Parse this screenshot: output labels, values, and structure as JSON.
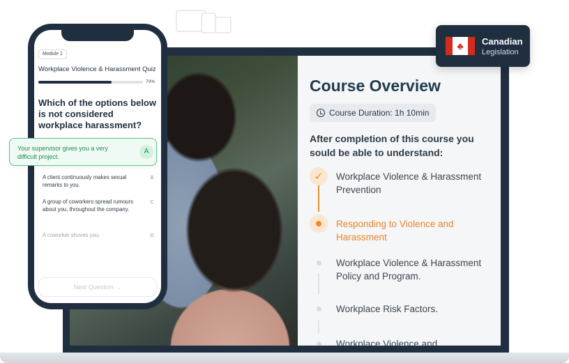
{
  "colors": {
    "brand_dark": "#1f2f3f",
    "accent_orange": "#ea8c2b",
    "correct_green": "#1f8a51",
    "flag_red": "#d52b1e"
  },
  "laptop": {
    "course": {
      "title": "Course Overview",
      "duration": "Course Duration: 1h 10min",
      "duration_icon": "clock-icon",
      "intro": "After completion of this course you sould be able to understand:",
      "steps": [
        {
          "label": "Workplace Violence & Harassment Prevention",
          "state": "done"
        },
        {
          "label": "Responding to Violence and Harassment",
          "state": "active"
        },
        {
          "label": "Workplace Violence & Harassment Policy and Program.",
          "state": "upcoming"
        },
        {
          "label": "Workplace Risk Factors.",
          "state": "upcoming"
        },
        {
          "label": "Workplace Violence and",
          "state": "upcoming"
        }
      ]
    }
  },
  "badge": {
    "line1": "Canadian",
    "line2": "Legislation",
    "icon": "canada-flag-icon"
  },
  "phone": {
    "module": "Module 1",
    "quiz_title": "Workplace Violence & Harassment Quiz",
    "progress": {
      "percent": 70,
      "label": "70%"
    },
    "question": "Which of the options below is not considered workplace harassment?",
    "options": [
      {
        "key": "A",
        "text": "Your supervisor gives you a very difficult project.",
        "selected": true
      },
      {
        "key": "B",
        "text": "A client continuously makes sexual remarks to you."
      },
      {
        "key": "C",
        "text": "A group of coworkers spread rumours about you, throughout the company."
      },
      {
        "key": "D",
        "text": "A coworker shoves you."
      }
    ],
    "next_button": "Next Question",
    "next_icon": "arrow-right-icon"
  }
}
